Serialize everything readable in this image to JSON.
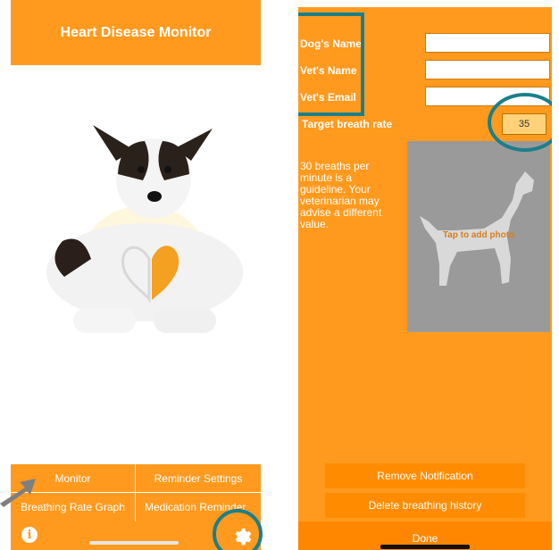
{
  "left_screen": {
    "title": "Heart Disease Monitor",
    "buttons": {
      "monitor": "Monitor",
      "reminder_settings": "Reminder Settings",
      "breathing_rate_graph": "Breathing Rate Graph",
      "medication_reminder": "Medication Reminder"
    },
    "icons": {
      "info": "info-icon",
      "settings": "gear-icon"
    }
  },
  "right_screen": {
    "fields": {
      "dogs_name_label": "Dog's Name",
      "dogs_name_value": "",
      "vets_name_label": "Vet's Name",
      "vets_name_value": "",
      "vets_email_label": "Vet's Email",
      "vets_email_value": ""
    },
    "target_breath_rate_label": "Target breath rate",
    "target_breath_rate_value": "35",
    "guideline_text": "30 breaths per minute is a guideline. Your veterinarian may advise a different value.",
    "photo_placeholder": "Tap to add photo",
    "remove_notification": "Remove Notification",
    "delete_history": "Delete breathing history",
    "done": "Done"
  },
  "colors": {
    "brand_orange": "#ff9a1e",
    "button_orange": "#ff8c00",
    "annotation_teal": "#1b7f8a",
    "photo_gray": "#9a9a9a"
  }
}
